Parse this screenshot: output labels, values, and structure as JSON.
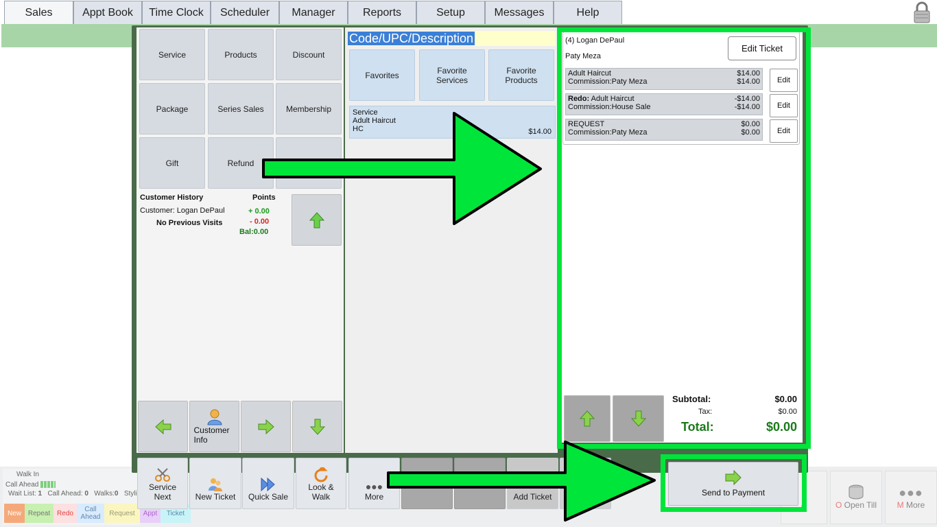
{
  "tabs": [
    "Sales",
    "Appt Book",
    "Time Clock",
    "Scheduler",
    "Manager",
    "Reports",
    "Setup",
    "Messages",
    "Help"
  ],
  "left": {
    "buttons": [
      "Service",
      "Products",
      "Discount",
      "Package",
      "Series Sales",
      "Membership",
      "Gift",
      "Refund",
      ""
    ],
    "history_title": "Customer History",
    "points_title": "Points",
    "customer_line": "Customer: Logan DePaul",
    "no_visits": "No Previous Visits",
    "points_plus": "+ 0.00",
    "points_minus": "- 0.00",
    "bal_label": "Bal:",
    "bal_value": "0.00",
    "customer_info": "Customer Info"
  },
  "mid": {
    "search_placeholder": "Code/UPC/Description",
    "fav_buttons": [
      "Favorites",
      "Favorite Services",
      "Favorite Products"
    ],
    "item": {
      "type": "Service",
      "name": "Adult Haircut",
      "code": "HC",
      "price": "$14.00"
    }
  },
  "ticket": {
    "header": "(4) Logan DePaul",
    "stylist": "Paty Meza",
    "edit_ticket": "Edit Ticket",
    "edit_label": "Edit",
    "lines": [
      {
        "prefix": "",
        "desc": "Adult Haircut",
        "price": "$14.00",
        "commission": "Commission:Paty Meza",
        "comm_price": "$14.00"
      },
      {
        "prefix": "Redo:",
        "desc": " Adult Haircut",
        "price": "-$14.00",
        "commission": "Commission:House Sale",
        "comm_price": "-$14.00"
      },
      {
        "prefix": "",
        "desc": "REQUEST",
        "price": "$0.00",
        "commission": "Commission:Paty Meza",
        "comm_price": "$0.00"
      }
    ],
    "subtotal_label": "Subtotal:",
    "subtotal": "$0.00",
    "tax_label": "Tax:",
    "tax": "$0.00",
    "total_label": "Total:",
    "total": "$0.00"
  },
  "toolbar": {
    "service_next": "Service Next",
    "new_ticket": "New Ticket",
    "quick_sale": "Quick Sale",
    "look_walk": "Look & Walk",
    "more": "More",
    "add_ticket": "Add Ticket",
    "send_to_payment": "Send to Payment"
  },
  "walkin": {
    "title": "Walk In",
    "call_ahead": "Call Ahead",
    "wait_list_label": "Wait List:",
    "wait_list": "1",
    "call_ahead_label": "Call Ahead:",
    "call_ahead_count": "0",
    "walks_label": "Walks:",
    "walks": "0",
    "stylists_label": "Styli",
    "legend": [
      "New",
      "Repeat",
      "Redo",
      "Call Ahead",
      "Request",
      "Appt",
      "Ticket"
    ]
  },
  "bottom_right": {
    "open_till": "Open Till",
    "more": "More",
    "amp": "&"
  },
  "colors": {
    "highlight_green": "#00e53a",
    "total_green": "#1a7a1a",
    "window_green": "#4a6b4a"
  }
}
